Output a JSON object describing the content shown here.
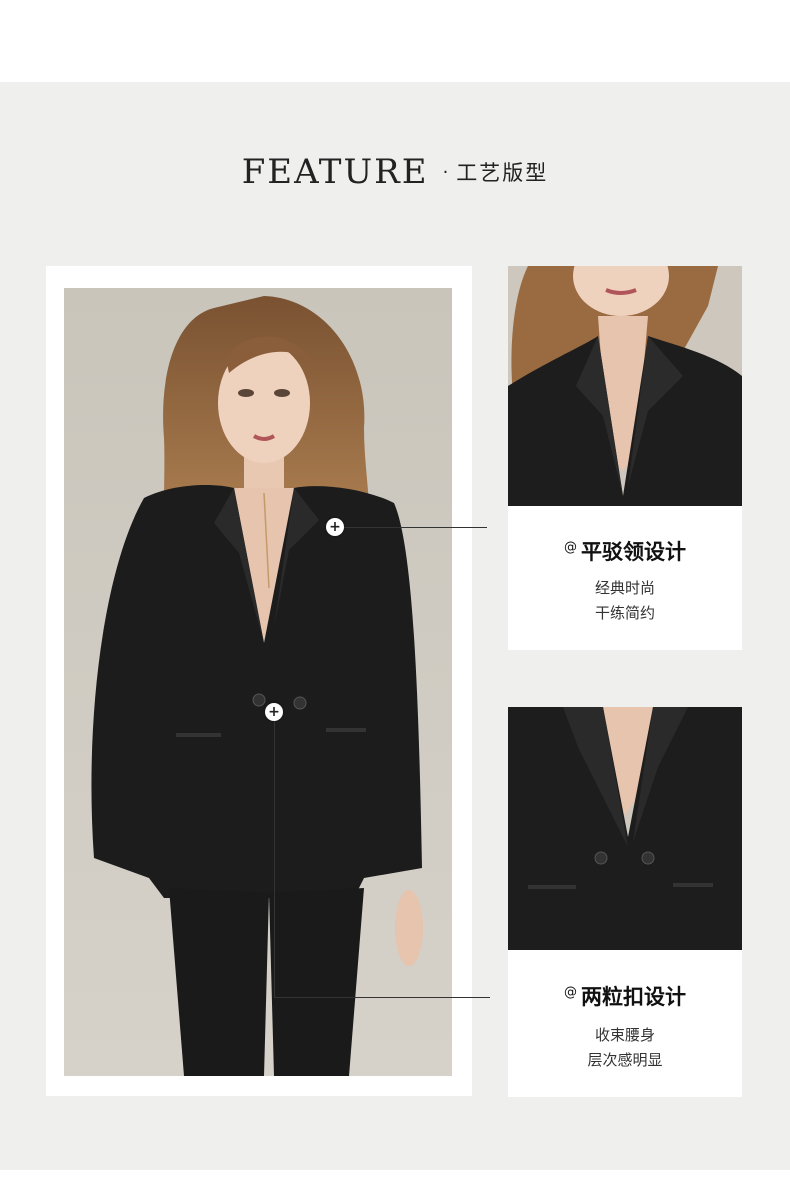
{
  "header": {
    "title_en": "FEATURE",
    "separator": "·",
    "title_cn": "工艺版型"
  },
  "hotspots": {
    "symbol": "+"
  },
  "features": [
    {
      "marker": "@",
      "title": "平驳领设计",
      "lines": [
        "经典时尚",
        "干练简约"
      ]
    },
    {
      "marker": "@",
      "title": "两粒扣设计",
      "lines": [
        "收束腰身",
        "层次感明显"
      ]
    }
  ],
  "colors": {
    "band": "#efefee",
    "suit": "#1c1c1c",
    "backdrop": "#cfcbc3",
    "hair": "#9a6a40"
  }
}
